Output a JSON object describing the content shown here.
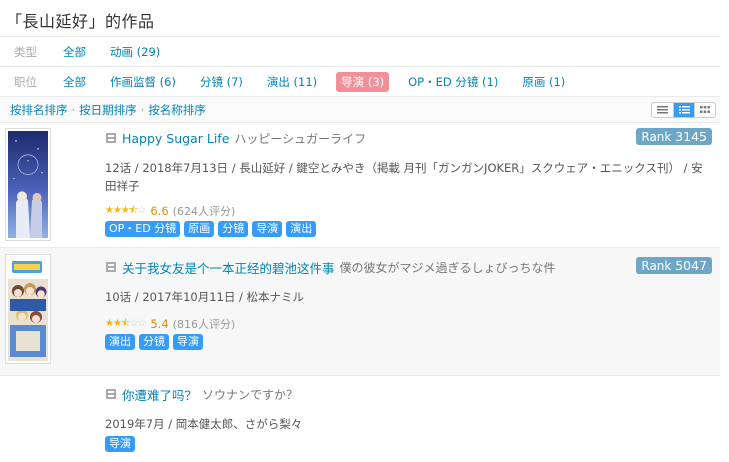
{
  "page_title": "「長山延好」的作品",
  "filters": {
    "type": {
      "label": "类型",
      "options": [
        "全部",
        "动画 (29)"
      ]
    },
    "position": {
      "label": "职位",
      "options": [
        "全部",
        "作画监督 (6)",
        "分镜 (7)",
        "演出 (11)",
        "导演 (3)",
        "OP・ED 分镜 (1)",
        "原画 (1)"
      ],
      "active_index": 4
    }
  },
  "sort": {
    "by_rank": "按排名排序",
    "by_date": "按日期排序",
    "by_name": "按名称排序",
    "separator": "·"
  },
  "view_modes": [
    "list-icon",
    "detail-list-icon",
    "grid-icon"
  ],
  "items": [
    {
      "title": "Happy Sugar Life",
      "original_title": "ハッピーシュガーライフ",
      "rank_label": "Rank",
      "rank": "3145",
      "info": "12话 / 2018年7月13日 / 長山延好 / 鍵空とみやき（掲載 月刊「ガンガンJOKER」スクウェア・エニックス刊） / 安田祥子",
      "stars": 3.5,
      "score": "6.6",
      "votes": "(624人评分)",
      "tags": [
        "OP・ED 分镜",
        "原画",
        "分镜",
        "导演",
        "演出"
      ]
    },
    {
      "title": "关于我女友是个一本正经的碧池这件事",
      "original_title": "僕の彼女がマジメ過ぎるしょびっちな件",
      "rank_label": "Rank",
      "rank": "5047",
      "info": "10话 / 2017年10月11日 / 松本ナミル",
      "stars": 2.5,
      "score": "5.4",
      "votes": "(816人评分)",
      "tags": [
        "演出",
        "分镜",
        "导演"
      ]
    },
    {
      "title": "你遭难了吗？",
      "original_title": "ソウナンですか？",
      "info": "2019年7月 / 岡本健太郎、さがら梨々",
      "tags": [
        "导演"
      ]
    }
  ],
  "colors": {
    "link": "#0084b4",
    "active_chip": "#f09199",
    "tag": "#369cf8",
    "rank": "#6ea6c7",
    "score": "#e58b00"
  }
}
